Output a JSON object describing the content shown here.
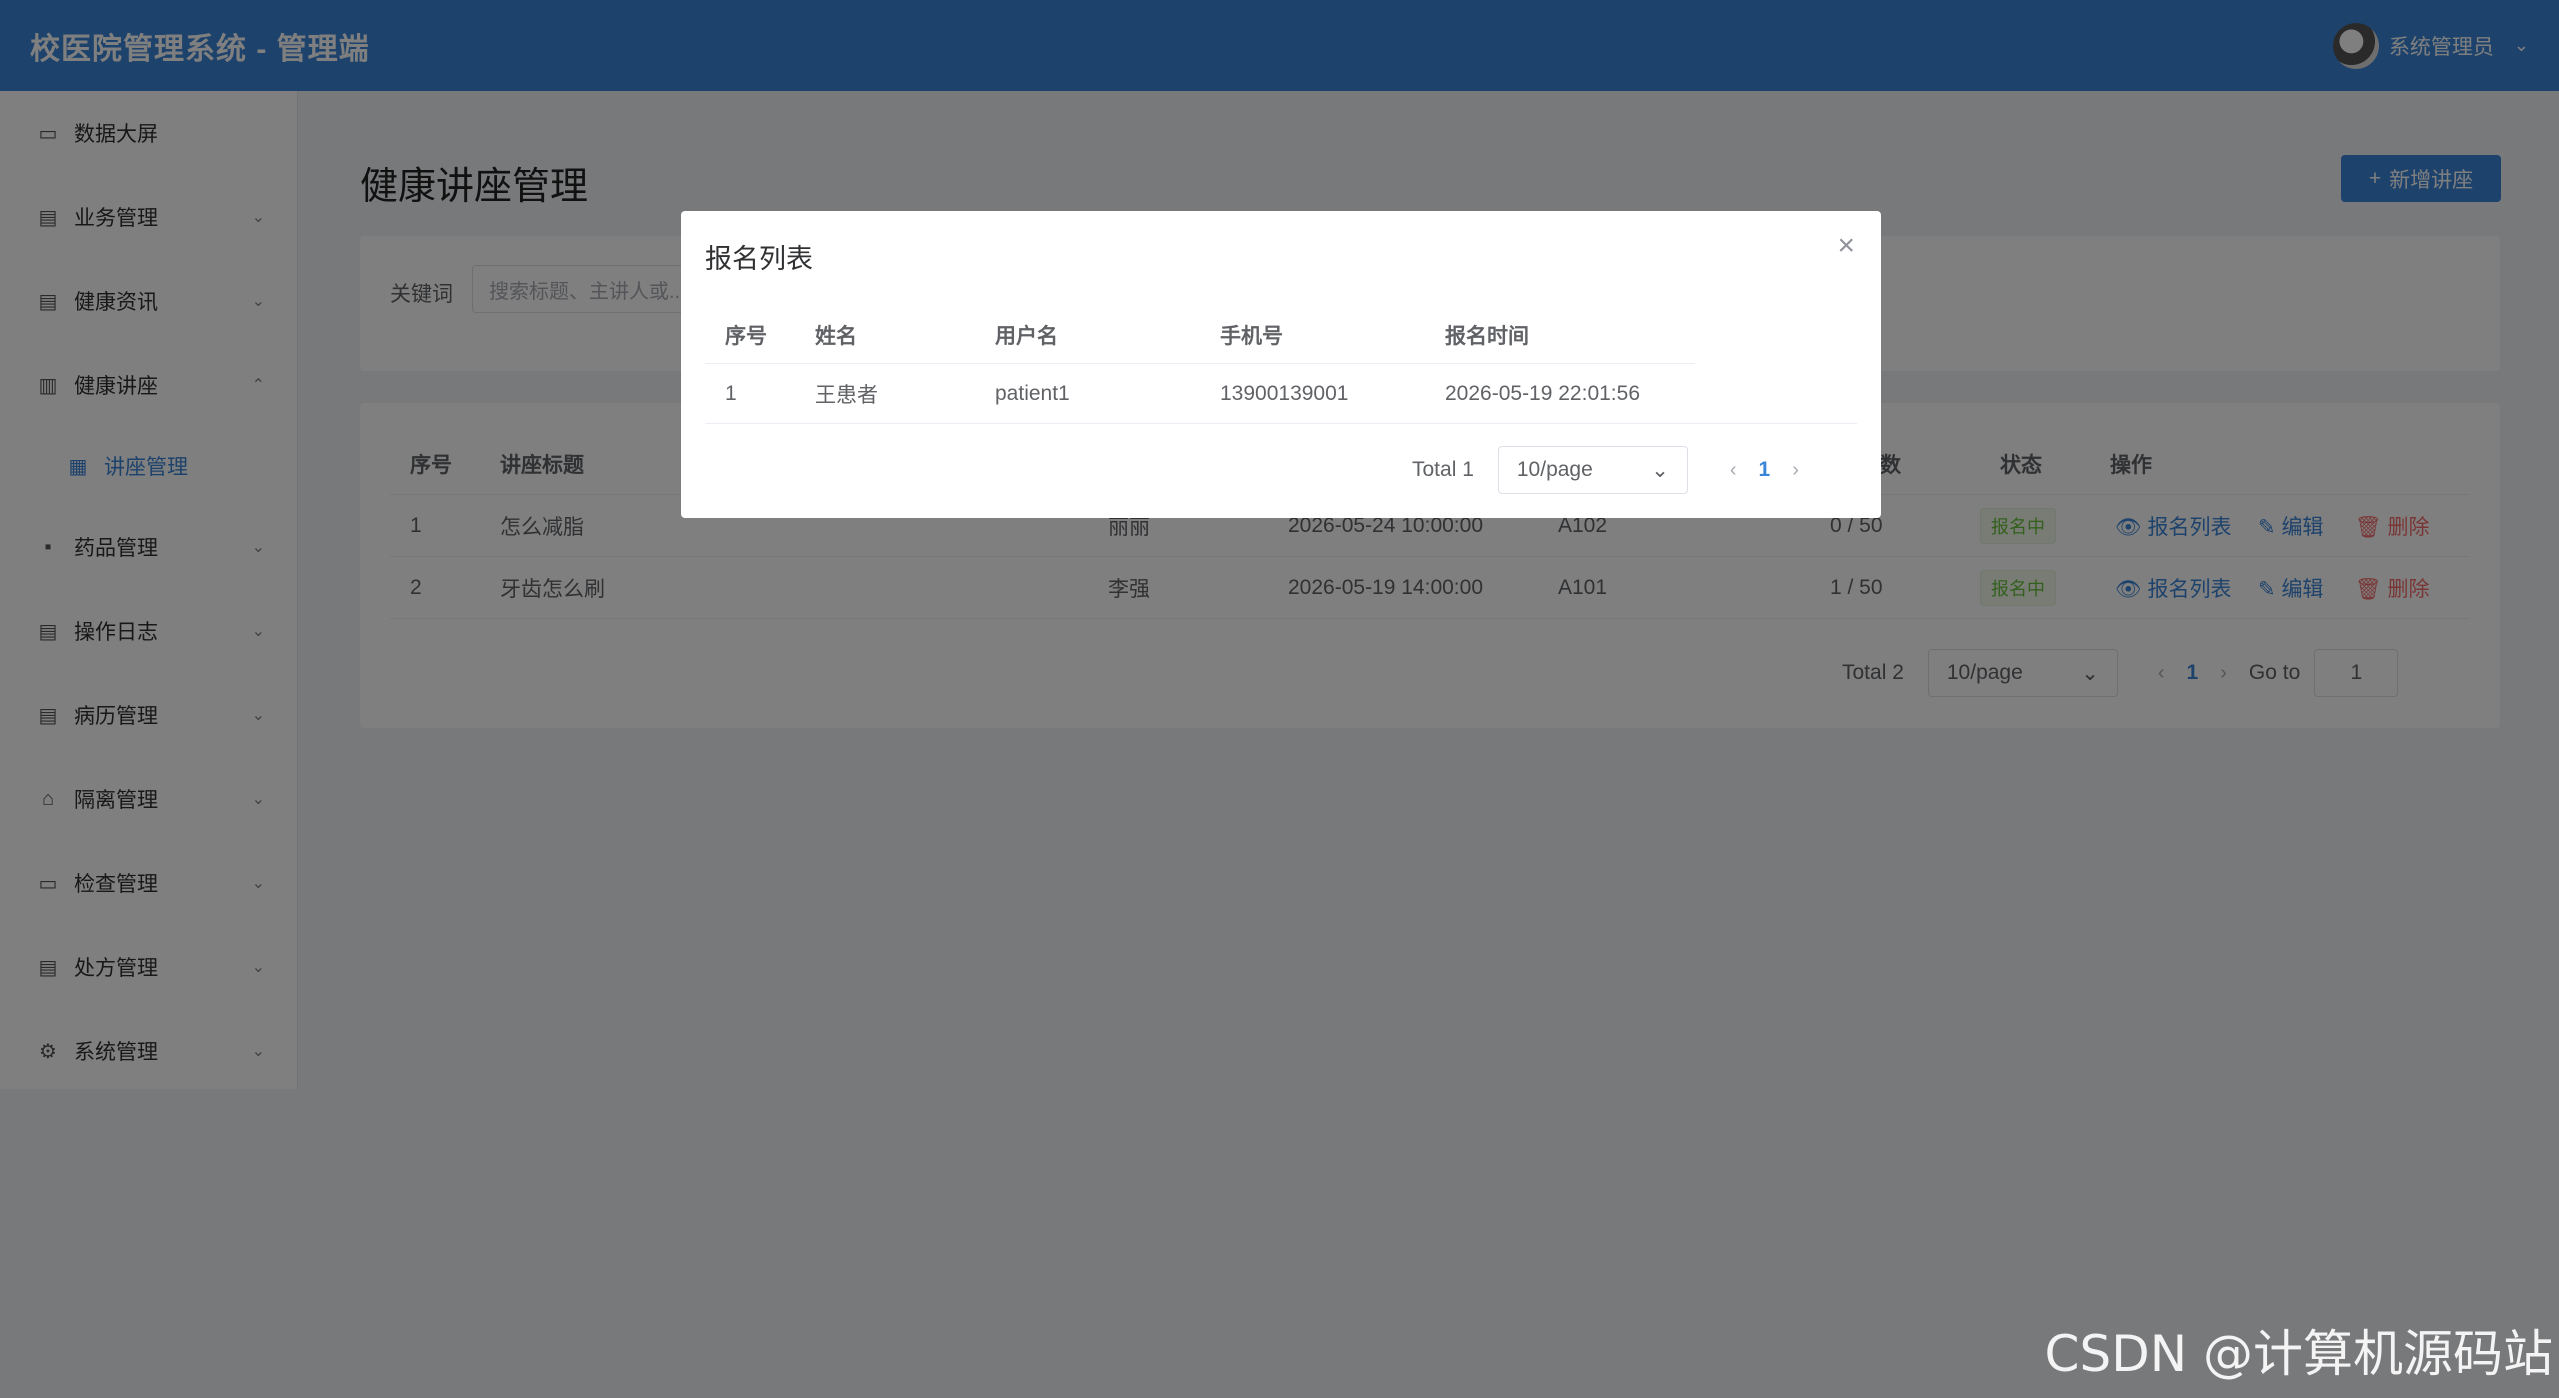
{
  "header": {
    "app_title": "校医院管理系统 - 管理端",
    "user_name": "系统管理员"
  },
  "sidebar": {
    "items": [
      {
        "label": "数据大屏",
        "icon": "monitor-icon"
      },
      {
        "label": "业务管理",
        "icon": "document-icon"
      },
      {
        "label": "健康资讯",
        "icon": "document-icon"
      },
      {
        "label": "健康讲座",
        "icon": "book-icon"
      },
      {
        "label": "讲座管理",
        "icon": "calendar-icon"
      },
      {
        "label": "药品管理",
        "icon": "grid-icon"
      },
      {
        "label": "操作日志",
        "icon": "document-icon"
      },
      {
        "label": "病历管理",
        "icon": "document-icon"
      },
      {
        "label": "隔离管理",
        "icon": "house-icon"
      },
      {
        "label": "检查管理",
        "icon": "monitor-icon"
      },
      {
        "label": "处方管理",
        "icon": "document-icon"
      },
      {
        "label": "系统管理",
        "icon": "gear-icon"
      }
    ]
  },
  "main": {
    "title": "健康讲座管理",
    "add_button": "新增讲座",
    "filter": {
      "label": "关键词",
      "placeholder": "搜索标题、主讲人或..."
    },
    "table": {
      "headers": {
        "index": "序号",
        "title": "讲座标题",
        "count": "数",
        "status": "状态",
        "ops": "操作"
      },
      "rows": [
        {
          "index": "1",
          "title": "怎么减脂",
          "speaker": "丽丽",
          "time": "2026-05-24 10:00:00",
          "room": "A102",
          "count": "0 / 50",
          "status": "报名中"
        },
        {
          "index": "2",
          "title": "牙齿怎么刷",
          "speaker": "李强",
          "time": "2026-05-19 14:00:00",
          "room": "A101",
          "count": "1 / 50",
          "status": "报名中"
        }
      ],
      "ops": {
        "view": "报名列表",
        "edit": "编辑",
        "delete": "删除"
      }
    },
    "pager": {
      "total": "Total 2",
      "size": "10/page",
      "page": "1",
      "goto_label": "Go to",
      "goto_value": "1"
    }
  },
  "modal": {
    "title": "报名列表",
    "headers": {
      "index": "序号",
      "name": "姓名",
      "username": "用户名",
      "phone": "手机号",
      "time": "报名时间"
    },
    "rows": [
      {
        "index": "1",
        "name": "王患者",
        "username": "patient1",
        "phone": "13900139001",
        "time": "2026-05-19 22:01:56"
      }
    ],
    "pager": {
      "total": "Total 1",
      "size": "10/page",
      "page": "1"
    }
  },
  "watermark": "CSDN @计算机源码站"
}
